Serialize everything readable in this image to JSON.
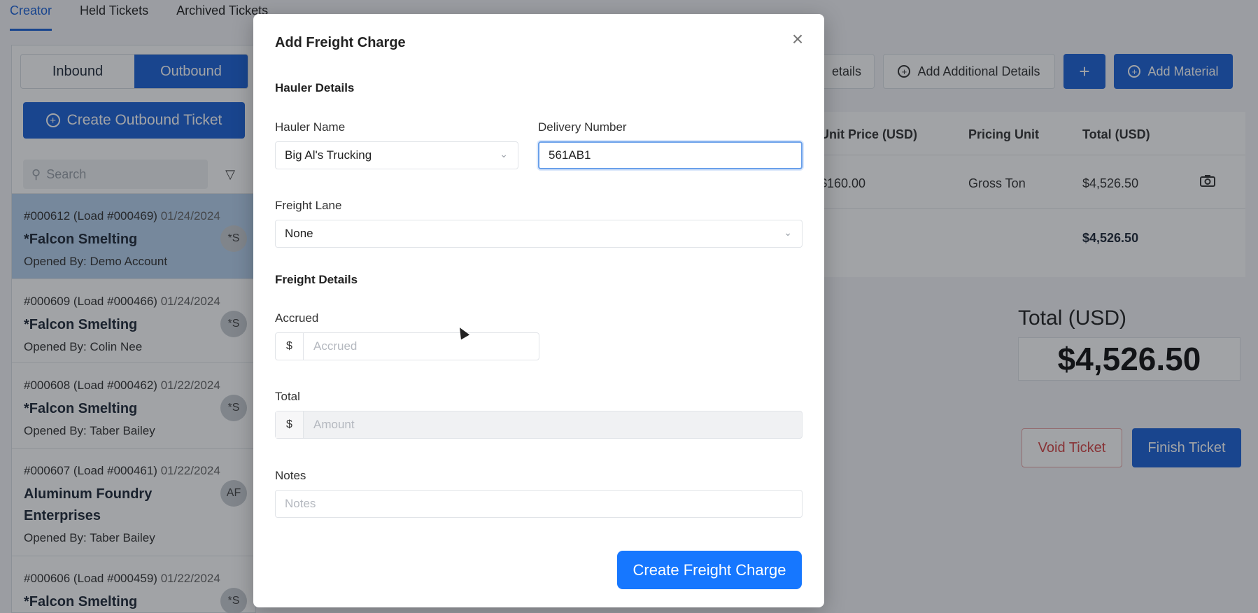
{
  "topnav": {
    "tabs": [
      {
        "label": "Creator"
      },
      {
        "label": "Held Tickets"
      },
      {
        "label": "Archived Tickets"
      }
    ]
  },
  "left": {
    "segments": [
      "Inbound",
      "Outbound"
    ],
    "create_label": "Create Outbound Ticket",
    "search_placeholder": "Search",
    "tickets": [
      {
        "id": "#000612 (Load #000469)",
        "date": "01/24/2024",
        "name": "*Falcon Smelting",
        "by": "Opened By: Demo Account",
        "avatar": "*S"
      },
      {
        "id": "#000609 (Load #000466)",
        "date": "01/24/2024",
        "name": "*Falcon Smelting",
        "by": "Opened By: Colin Nee",
        "avatar": "*S"
      },
      {
        "id": "#000608 (Load #000462)",
        "date": "01/22/2024",
        "name": "*Falcon Smelting",
        "by": "Opened By: Taber Bailey",
        "avatar": "*S"
      },
      {
        "id": "#000607 (Load #000461)",
        "date": "01/22/2024",
        "name": "Aluminum Foundry Enterprises",
        "by": "Opened By: Taber Bailey",
        "avatar": "AF"
      },
      {
        "id": "#000606 (Load #000459)",
        "date": "01/22/2024",
        "name": "*Falcon Smelting",
        "by": "",
        "avatar": "*S"
      }
    ]
  },
  "right": {
    "details_label": "etails",
    "add_details_label": "Add Additional Details",
    "plus_label": "+",
    "add_material_label": "Add Material",
    "table": {
      "headers": [
        "Unit Price (USD)",
        "Pricing Unit",
        "Total (USD)"
      ],
      "row": [
        "$160.00",
        "Gross Ton",
        "$4,526.50"
      ],
      "total": "$4,526.50"
    },
    "total_label": "Total (USD)",
    "total_value": "$4,526.50",
    "void_label": "Void Ticket",
    "finish_label": "Finish Ticket"
  },
  "modal": {
    "title": "Add Freight Charge",
    "hauler_section": "Hauler Details",
    "hauler_name_label": "Hauler Name",
    "hauler_name_value": "Big Al's Trucking",
    "delivery_label": "Delivery Number",
    "delivery_value": "561AB1",
    "lane_label": "Freight Lane",
    "lane_value": "None",
    "freight_section": "Freight Details",
    "accrued_label": "Accrued",
    "accrued_placeholder": "Accrued",
    "total_label": "Total",
    "total_placeholder": "Amount",
    "currency_symbol": "$",
    "notes_label": "Notes",
    "notes_placeholder": "Notes",
    "submit_label": "Create Freight Charge"
  }
}
